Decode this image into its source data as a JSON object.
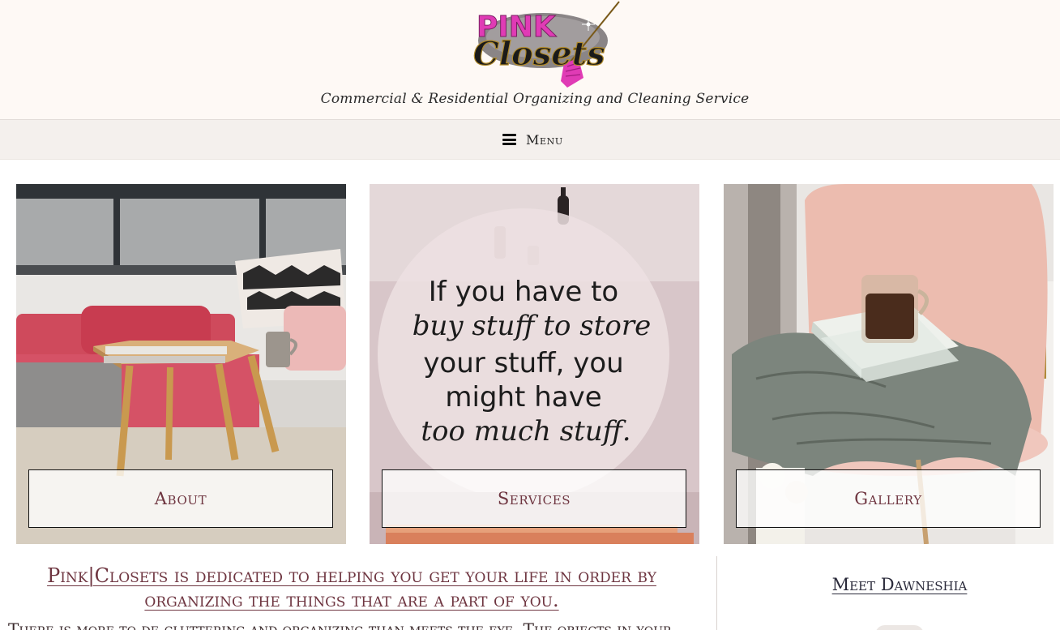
{
  "header": {
    "logo_text_top": "PINK",
    "logo_text_bottom": "Closets",
    "tagline": "Commercial & Residential Organizing and Cleaning Service"
  },
  "nav": {
    "menu_label": "Menu",
    "menu_icon": "hamburger-icon"
  },
  "cards": [
    {
      "label": "About",
      "image": "living-room-photo"
    },
    {
      "label": "Services",
      "image": "quote-image",
      "quote_lines": [
        "If you have to",
        "buy stuff to store",
        "your stuff, you",
        "might have",
        "too much stuff."
      ]
    },
    {
      "label": "Gallery",
      "image": "coffee-chair-photo"
    }
  ],
  "main": {
    "headline": "Pink|Closets is dedicated to helping you get your life in order by organizing the things that are a part of you.",
    "body_partial": "There is more to de-cluttering and organizing than meets the eye. The objects in your"
  },
  "sidebar": {
    "meet_link": "Meet Dawneshia"
  },
  "colors": {
    "brand_pink": "#e03bb5",
    "brand_gold": "#8b6a1d",
    "accent_text": "#6e3540",
    "header_bg": "#fef9f5",
    "nav_bg": "#f4f0ed"
  }
}
